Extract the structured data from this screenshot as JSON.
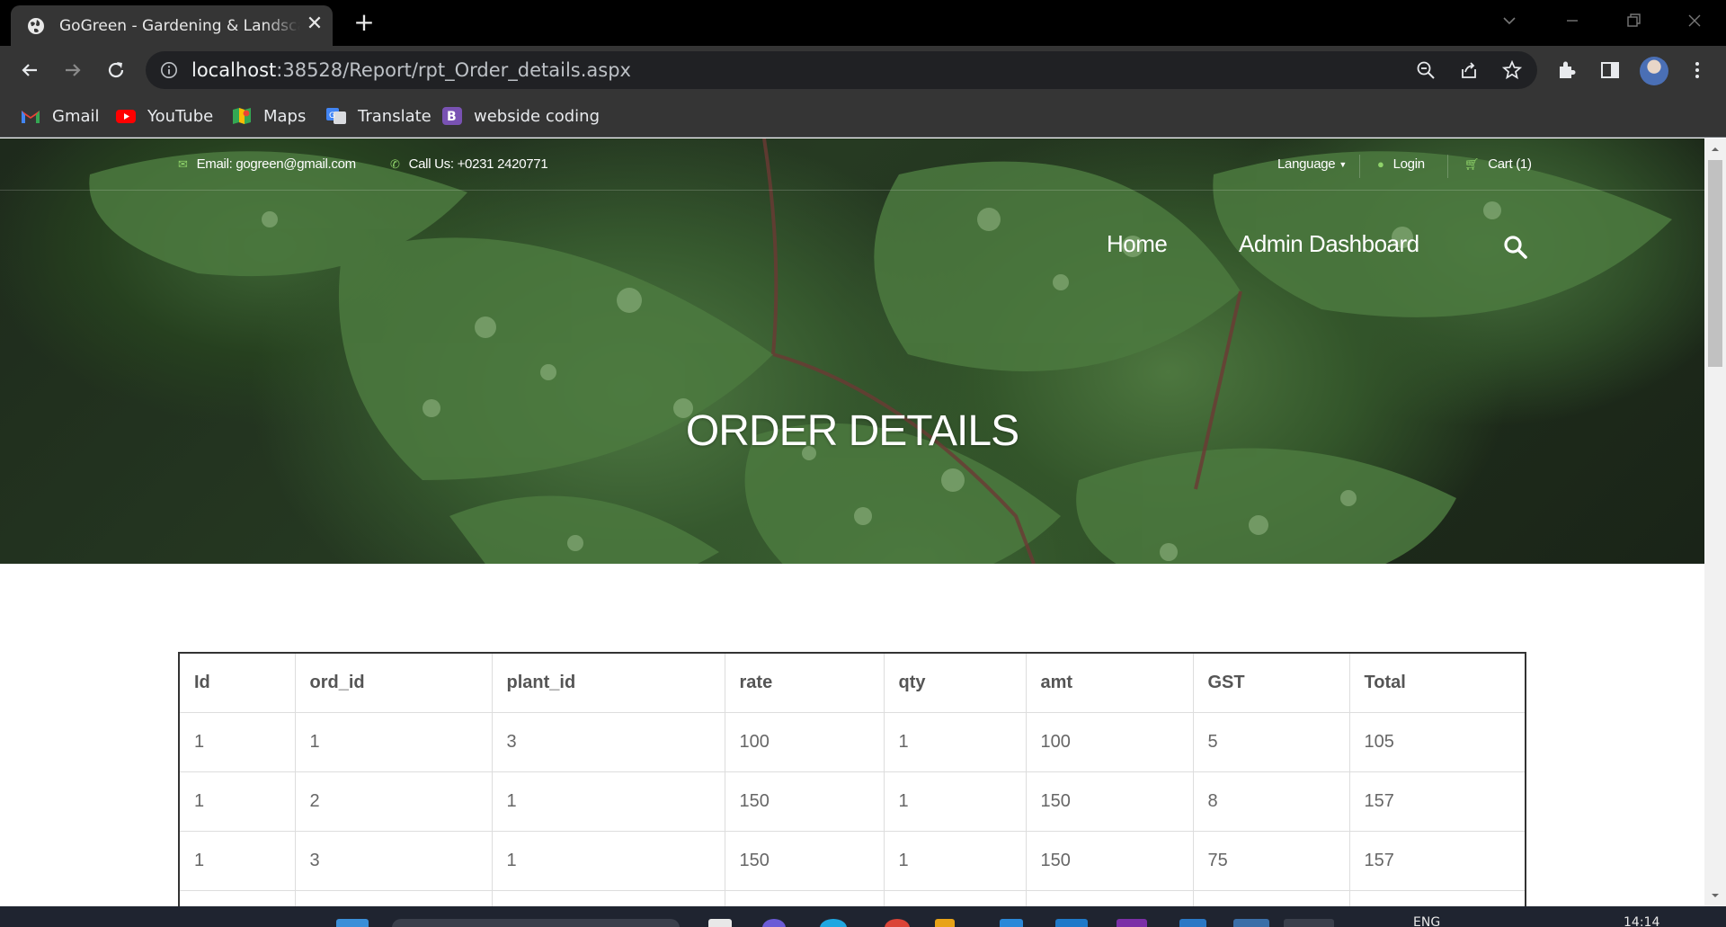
{
  "browser": {
    "tab_title": "GoGreen - Gardening & Landscaping",
    "url_host": "localhost",
    "url_path": ":38528/Report/rpt_Order_details.aspx",
    "bookmarks": [
      {
        "label": "Gmail",
        "icon": "gmail-icon"
      },
      {
        "label": "YouTube",
        "icon": "youtube-icon"
      },
      {
        "label": "Maps",
        "icon": "maps-icon"
      },
      {
        "label": "Translate",
        "icon": "translate-icon"
      },
      {
        "label": "webside coding",
        "icon": "bootstrap-icon"
      }
    ]
  },
  "site": {
    "topbar": {
      "email": "Email: gogreen@gmail.com",
      "phone": "Call Us: +0231 2420771",
      "language": "Language",
      "login": "Login",
      "cart": "Cart (1)"
    },
    "nav": {
      "home": "Home",
      "admin": "Admin Dashboard"
    },
    "hero_title": "ORDER DETAILS",
    "accent_color": "#6cc04a"
  },
  "table": {
    "headers": [
      "Id",
      "ord_id",
      "plant_id",
      "rate",
      "qty",
      "amt",
      "GST",
      "Total"
    ],
    "rows": [
      [
        "1",
        "1",
        "3",
        "100",
        "1",
        "100",
        "5",
        "105"
      ],
      [
        "1",
        "2",
        "1",
        "150",
        "1",
        "150",
        "8",
        "157"
      ],
      [
        "1",
        "3",
        "1",
        "150",
        "1",
        "150",
        "75",
        "157"
      ],
      [
        "",
        "",
        "",
        "",
        "",
        "",
        "",
        ""
      ]
    ]
  },
  "taskbar": {
    "lang": "ENG",
    "time": "14:14"
  }
}
